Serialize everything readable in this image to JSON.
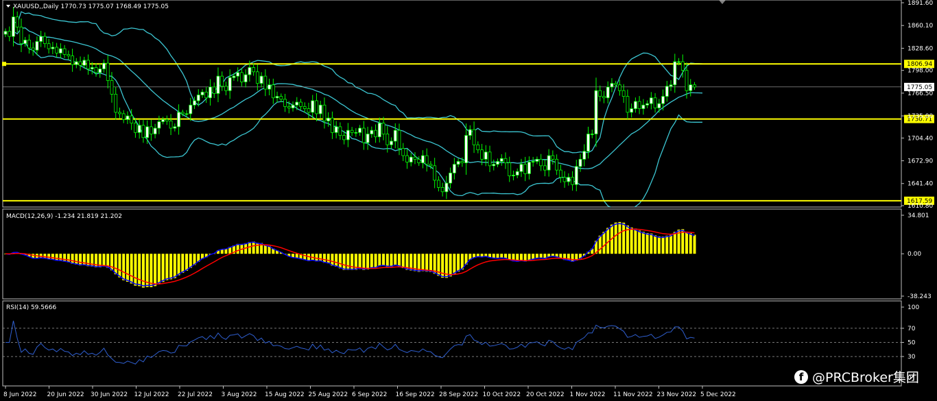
{
  "header": {
    "main_title": "XAUUSD,,Daily  1770.73 1775.07 1768.49 1775.05",
    "macd_title": "MACD(12,26,9) -1.234 21.819 21.202",
    "rsi_title": "RSI(14) 59.5666"
  },
  "colors": {
    "background": "#000000",
    "bull_candle": "#ffffff",
    "bear_candle": "#000000",
    "candle_outline": "#00ff00",
    "bollinger": "#3cc6d2",
    "support_resistance": "#ffff00",
    "macd_hist": "#ffff00",
    "macd_line": "#0000ff",
    "signal_line": "#ff0000",
    "rsi_line": "#2f5fd0"
  },
  "price_axis": {
    "ticks": [
      "1891.60",
      "1860.10",
      "1828.60",
      "1798.00",
      "1766.50",
      "1735.00",
      "1704.40",
      "1672.90",
      "1641.40",
      "1610.80"
    ]
  },
  "levels": [
    {
      "label": "1806.94",
      "value": 1806.94,
      "style": "yellow"
    },
    {
      "label": "1775.05",
      "value": 1775.05,
      "style": "white"
    },
    {
      "label": "1730.71",
      "value": 1730.71,
      "style": "yellow"
    },
    {
      "label": "1617.59",
      "value": 1617.59,
      "style": "yellow"
    }
  ],
  "macd_axis": {
    "ticks": [
      "34.801",
      "0.00",
      "-38.243"
    ]
  },
  "rsi_axis": {
    "ticks": [
      "100",
      "70",
      "50",
      "30",
      "0"
    ]
  },
  "date_axis": {
    "labels": [
      "8 Jun 2022",
      "20 Jun 2022",
      "30 Jun 2022",
      "12 Jul 2022",
      "22 Jul 2022",
      "3 Aug 2022",
      "15 Aug 2022",
      "25 Aug 2022",
      "6 Sep 2022",
      "16 Sep 2022",
      "28 Sep 2022",
      "10 Oct 2022",
      "20 Oct 2022",
      "1 Nov 2022",
      "11 Nov 2022",
      "23 Nov 2022",
      "5 Dec 2022"
    ]
  },
  "watermark": {
    "logo": "f",
    "text": "@PRCBroker集团"
  },
  "chart_data": {
    "type": "candlestick",
    "symbol": "XAUUSD",
    "timeframe": "Daily",
    "ylim": [
      1610.8,
      1891.6
    ],
    "close": [
      1852,
      1845,
      1872,
      1858,
      1835,
      1840,
      1829,
      1826,
      1838,
      1845,
      1835,
      1828,
      1830,
      1822,
      1828,
      1820,
      1818,
      1806,
      1810,
      1805,
      1812,
      1800,
      1802,
      1795,
      1800,
      1808,
      1784,
      1765,
      1740,
      1738,
      1730,
      1735,
      1725,
      1712,
      1722,
      1705,
      1720,
      1710,
      1718,
      1727,
      1730,
      1728,
      1718,
      1720,
      1740,
      1738,
      1738,
      1750,
      1756,
      1764,
      1768,
      1760,
      1775,
      1766,
      1790,
      1776,
      1770,
      1788,
      1790,
      1795,
      1782,
      1792,
      1802,
      1796,
      1780,
      1790,
      1772,
      1778,
      1760,
      1762,
      1758,
      1748,
      1746,
      1750,
      1754,
      1748,
      1745,
      1740,
      1756,
      1738,
      1750,
      1728,
      1732,
      1712,
      1720,
      1708,
      1702,
      1715,
      1712,
      1712,
      1718,
      1698,
      1710,
      1715,
      1706,
      1725,
      1710,
      1695,
      1700,
      1715,
      1690,
      1680,
      1671,
      1678,
      1675,
      1670,
      1680,
      1668,
      1666,
      1646,
      1636,
      1630,
      1642,
      1656,
      1668,
      1672,
      1670,
      1708,
      1716,
      1695,
      1688,
      1675,
      1685,
      1666,
      1668,
      1672,
      1676,
      1670,
      1652,
      1653,
      1658,
      1668,
      1655,
      1671,
      1672,
      1675,
      1666,
      1660,
      1680,
      1675,
      1660,
      1650,
      1644,
      1650,
      1640,
      1665,
      1675,
      1686,
      1710,
      1710,
      1770,
      1762,
      1760,
      1775,
      1780,
      1778,
      1770,
      1762,
      1740,
      1745,
      1755,
      1745,
      1750,
      1752,
      1760,
      1746,
      1752,
      1762,
      1776,
      1778,
      1810,
      1810,
      1798,
      1770,
      1778,
      1775
    ]
  }
}
